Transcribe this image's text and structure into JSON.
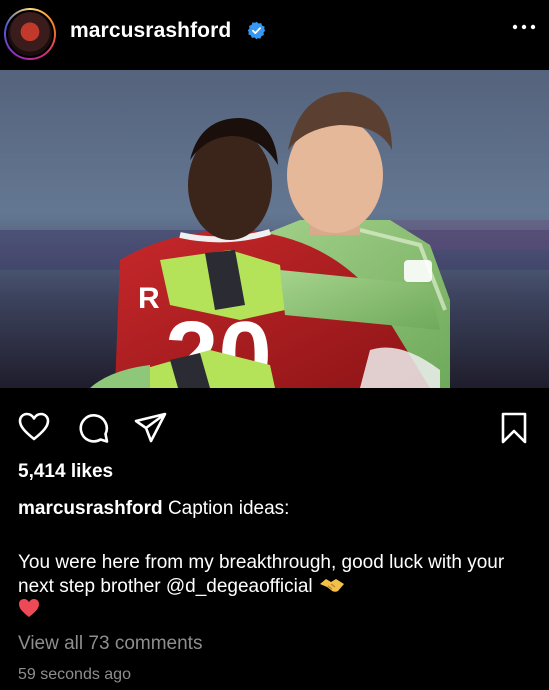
{
  "post": {
    "username": "marcusrashford",
    "likes": "5,414 likes",
    "caption_username": "marcusrashford",
    "caption_title": "Caption ideas:",
    "caption_body": "You were here from my breakthrough, good luck with your next step brother @d_degeaofficial",
    "view_comments": "View all 73 comments",
    "timestamp": "59 seconds ago"
  },
  "photo": {
    "shirt_text": "R",
    "shirt_number": "20"
  },
  "icons": {
    "like": "heart-outline-icon",
    "comment": "speech-bubble-icon",
    "share": "paper-plane-icon",
    "save": "bookmark-icon",
    "more": "ellipsis-icon",
    "verified": "verified-badge-icon"
  },
  "colors": {
    "verified": "#3897f0",
    "secondary_text": "#8e8e8e",
    "heart_emoji": "#ed4956"
  }
}
